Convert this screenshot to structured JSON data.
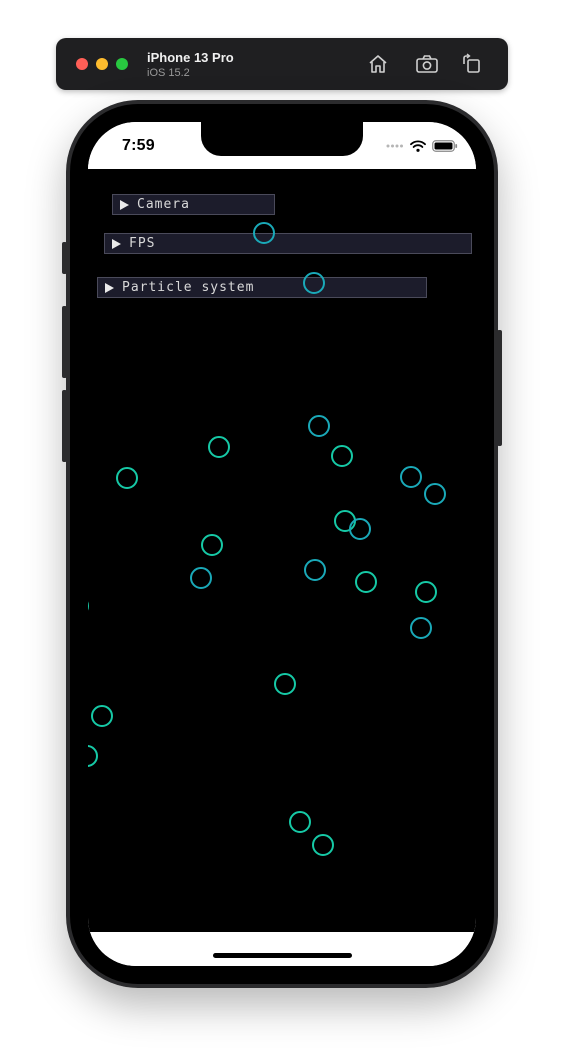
{
  "simulator": {
    "device_name": "iPhone 13 Pro",
    "os_version": "iOS 15.2",
    "toolbar_icons": [
      "home-icon",
      "camera-icon",
      "rotate-icon"
    ],
    "traffic_colors": {
      "close": "#ff5f57",
      "minimize": "#febc2e",
      "zoom": "#28c840"
    }
  },
  "status_bar": {
    "time": "7:59",
    "icons": [
      "signal-dots-icon",
      "wifi-icon",
      "battery-icon"
    ]
  },
  "panels": {
    "camera": "Camera",
    "fps": "FPS",
    "particle_system": "Particle system"
  },
  "particles": {
    "stroke_colors": [
      "#1aa9b8",
      "#16c9a6"
    ]
  }
}
